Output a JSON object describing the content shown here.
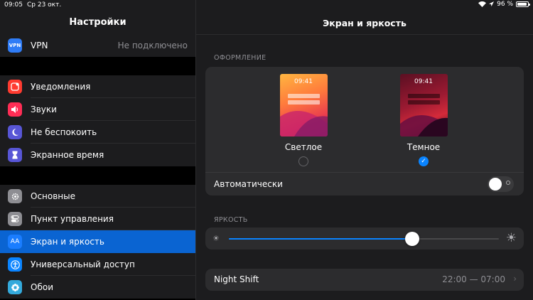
{
  "status_bar": {
    "time": "09:05",
    "date": "Ср 23 окт.",
    "battery": "96 %",
    "battery_level": 0.96
  },
  "sidebar": {
    "title": "Настройки",
    "vpn": {
      "label": "VPN",
      "value": "Не подключено",
      "icon": "VPN",
      "color": "#2f7cf6"
    },
    "group1": [
      {
        "label": "Уведомления",
        "icon": "bell-icon",
        "color": "#ff3b30"
      },
      {
        "label": "Звуки",
        "icon": "speaker-icon",
        "color": "#ff2d55"
      },
      {
        "label": "Не беспокоить",
        "icon": "moon-icon",
        "color": "#5856d6"
      },
      {
        "label": "Экранное время",
        "icon": "hourglass-icon",
        "color": "#5856d6"
      }
    ],
    "group2": [
      {
        "label": "Основные",
        "icon": "gear-icon",
        "color": "#8e8e93"
      },
      {
        "label": "Пункт управления",
        "icon": "toggles-icon",
        "color": "#8e8e93"
      },
      {
        "label": "Экран и яркость",
        "icon": "AA",
        "color": "#0a64d2",
        "active": true
      },
      {
        "label": "Универсальный доступ",
        "icon": "accessibility-icon",
        "color": "#0a84ff"
      },
      {
        "label": "Обои",
        "icon": "flower-icon",
        "color": "#34aadc"
      }
    ]
  },
  "main": {
    "title": "Экран и яркость",
    "appearance": {
      "section_label": "ОФОРМЛЕНИЕ",
      "light": {
        "label": "Светлое",
        "preview_time": "09:41",
        "selected": false
      },
      "dark": {
        "label": "Темное",
        "preview_time": "09:41",
        "selected": true
      },
      "automatic_label": "Автоматически",
      "automatic_on": false
    },
    "brightness": {
      "section_label": "ЯРКОСТЬ",
      "level": 0.68
    },
    "night_shift": {
      "label": "Night Shift",
      "value": "22:00 — 07:00"
    }
  },
  "colors": {
    "accent": "#0a84ff",
    "active_row": "#0a64d2"
  }
}
